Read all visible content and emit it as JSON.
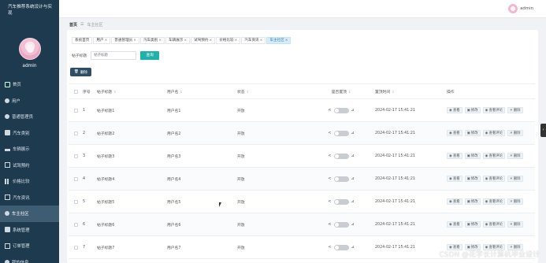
{
  "app": {
    "title": "汽车推荐系统设计与实现",
    "user": "admin"
  },
  "sidebar": {
    "items": [
      {
        "label": "首页",
        "icon": "home-icon"
      },
      {
        "label": "用户",
        "icon": "user-icon"
      },
      {
        "label": "普通管理员",
        "icon": "user-icon"
      },
      {
        "label": "汽车类别",
        "icon": "box-icon"
      },
      {
        "label": "车辆展示",
        "icon": "car-icon"
      },
      {
        "label": "试驾预约",
        "icon": "doc-icon"
      },
      {
        "label": "价格比较",
        "icon": "chart-icon"
      },
      {
        "label": "汽车资讯",
        "icon": "doc-icon"
      },
      {
        "label": "车主社区",
        "icon": "user-icon"
      },
      {
        "label": "系统管理",
        "icon": "box-icon"
      },
      {
        "label": "订单管理",
        "icon": "doc-icon"
      },
      {
        "label": "我的信息",
        "icon": "user-icon"
      }
    ],
    "active_index": 8
  },
  "breadcrumb": {
    "home": "首页",
    "current": "车主社区"
  },
  "tabs": [
    {
      "label": "系统首页",
      "closable": false
    },
    {
      "label": "用户",
      "closable": true
    },
    {
      "label": "普通管理员",
      "closable": true
    },
    {
      "label": "汽车类别",
      "closable": true
    },
    {
      "label": "车辆展示",
      "closable": true
    },
    {
      "label": "试驾预约",
      "closable": true
    },
    {
      "label": "价格比较",
      "closable": true
    },
    {
      "label": "汽车资讯",
      "closable": true
    },
    {
      "label": "车主社区",
      "closable": true
    }
  ],
  "search": {
    "label": "帖子标题",
    "placeholder": "帖子标题",
    "button": "查询"
  },
  "delete_button": "删除",
  "table": {
    "headers": [
      "序号",
      "帖子标题",
      "用户名",
      "状态",
      "是否置顶",
      "置顶时间",
      "操作"
    ],
    "rows": [
      {
        "seq": "1",
        "title": "帖子标题1",
        "user": "用户名1",
        "status": "开放",
        "time": "2024-02-17 15:41:21"
      },
      {
        "seq": "2",
        "title": "帖子标题2",
        "user": "用户名2",
        "status": "开放",
        "time": "2024-02-17 15:41:21"
      },
      {
        "seq": "3",
        "title": "帖子标题3",
        "user": "用户名3",
        "status": "开放",
        "time": "2024-02-17 15:41:21"
      },
      {
        "seq": "4",
        "title": "帖子标题4",
        "user": "用户名4",
        "status": "开放",
        "time": "2024-02-17 15:41:21"
      },
      {
        "seq": "5",
        "title": "帖子标题5",
        "user": "用户名5",
        "status": "开放",
        "time": "2024-02-17 15:41:21"
      },
      {
        "seq": "6",
        "title": "帖子标题6",
        "user": "用户名6",
        "status": "开放",
        "time": "2024-02-17 15:41:21"
      },
      {
        "seq": "7",
        "title": "帖子标题7",
        "user": "用户名7",
        "status": "开放",
        "time": "2024-02-17 15:41:21"
      }
    ],
    "actions": {
      "view": "查看",
      "edit": "修改",
      "comment": "查看评论",
      "delete": "删除"
    }
  },
  "watermark": "CSDN @花学长计算机毕业设计"
}
